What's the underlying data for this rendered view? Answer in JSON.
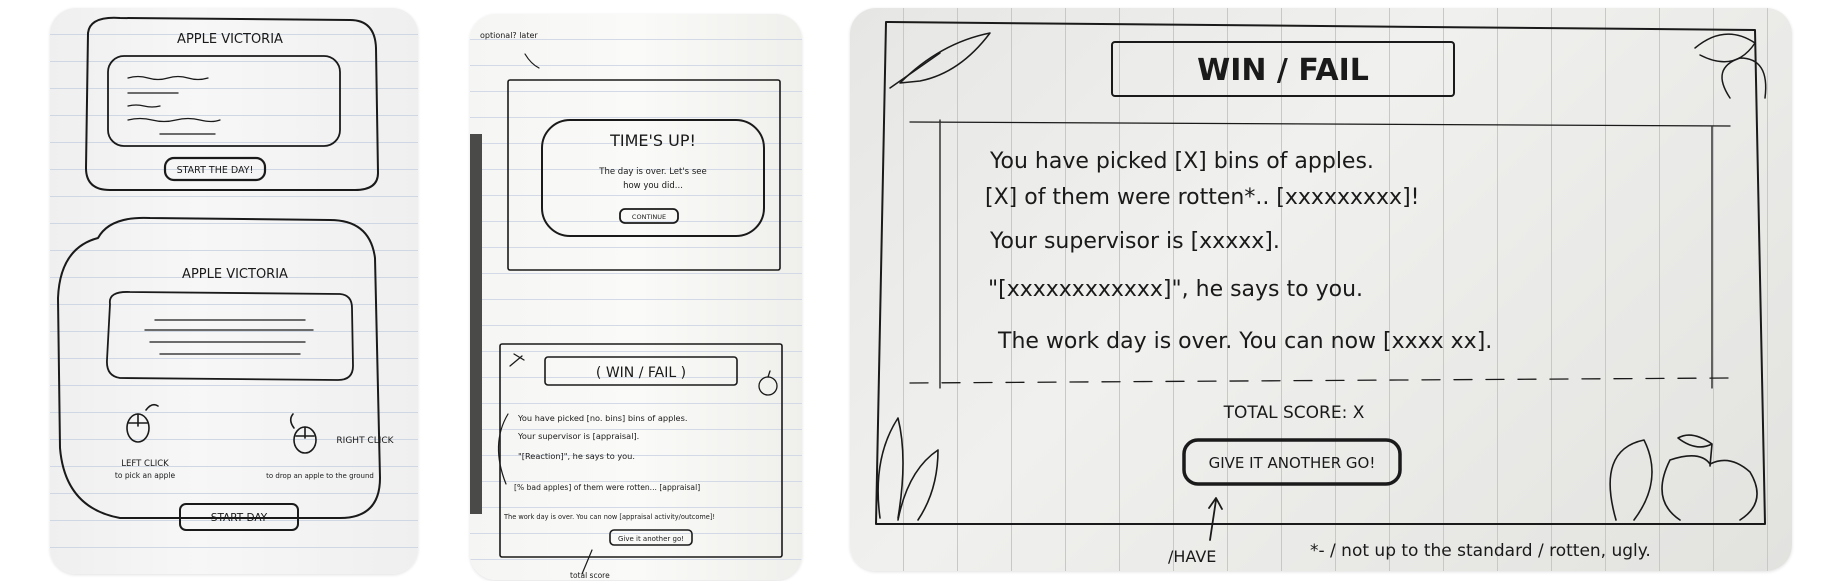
{
  "page1": {
    "top_frame": {
      "title": "APPLE VICTORIA",
      "button_label": "START THE DAY!"
    },
    "bottom_frame": {
      "title": "APPLE VICTORIA",
      "left_click_label": "LEFT CLICK",
      "left_click_desc": "to pick an apple",
      "right_click_label": "RIGHT CLICK",
      "right_click_desc": "to drop an apple to the ground",
      "button_label": "START DAY"
    }
  },
  "page2": {
    "side_note": "optional? later",
    "times_up": {
      "title": "TIME'S UP!",
      "line1": "The day is over. Let's see",
      "line2": "how you did...",
      "button_label": "CONTINUE"
    },
    "win_fail": {
      "title": "( WIN / FAIL )",
      "line1": "You have picked [no. bins] bins of apples.",
      "line2": "Your supervisor is [appraisal].",
      "line3": "\"[Reaction]\", he says to you.",
      "line4": "[% bad apples] of them were rotten... [appraisal]",
      "line5": "The work day is over. You can now [appraisal activity/outcome]!",
      "button_label": "Give it another go!",
      "footnote": "total score"
    }
  },
  "page3": {
    "title": "WIN / FAIL",
    "line1": "You have picked [X] bins of apples.",
    "line2": "[X] of them were rotten*.. [xxxxxxxxx]!",
    "line3": "Your supervisor is [xxxxx].",
    "line4": "\"[xxxxxxxxxxxx]\", he says to you.",
    "line5": "The work day is over. You can now [xxxx xx].",
    "total_score": "TOTAL SCORE: X",
    "button_label": "GIVE IT ANOTHER GO!",
    "arrow_note": "/HAVE",
    "footnote": "*- / not up to the standard / rotten, ugly."
  }
}
